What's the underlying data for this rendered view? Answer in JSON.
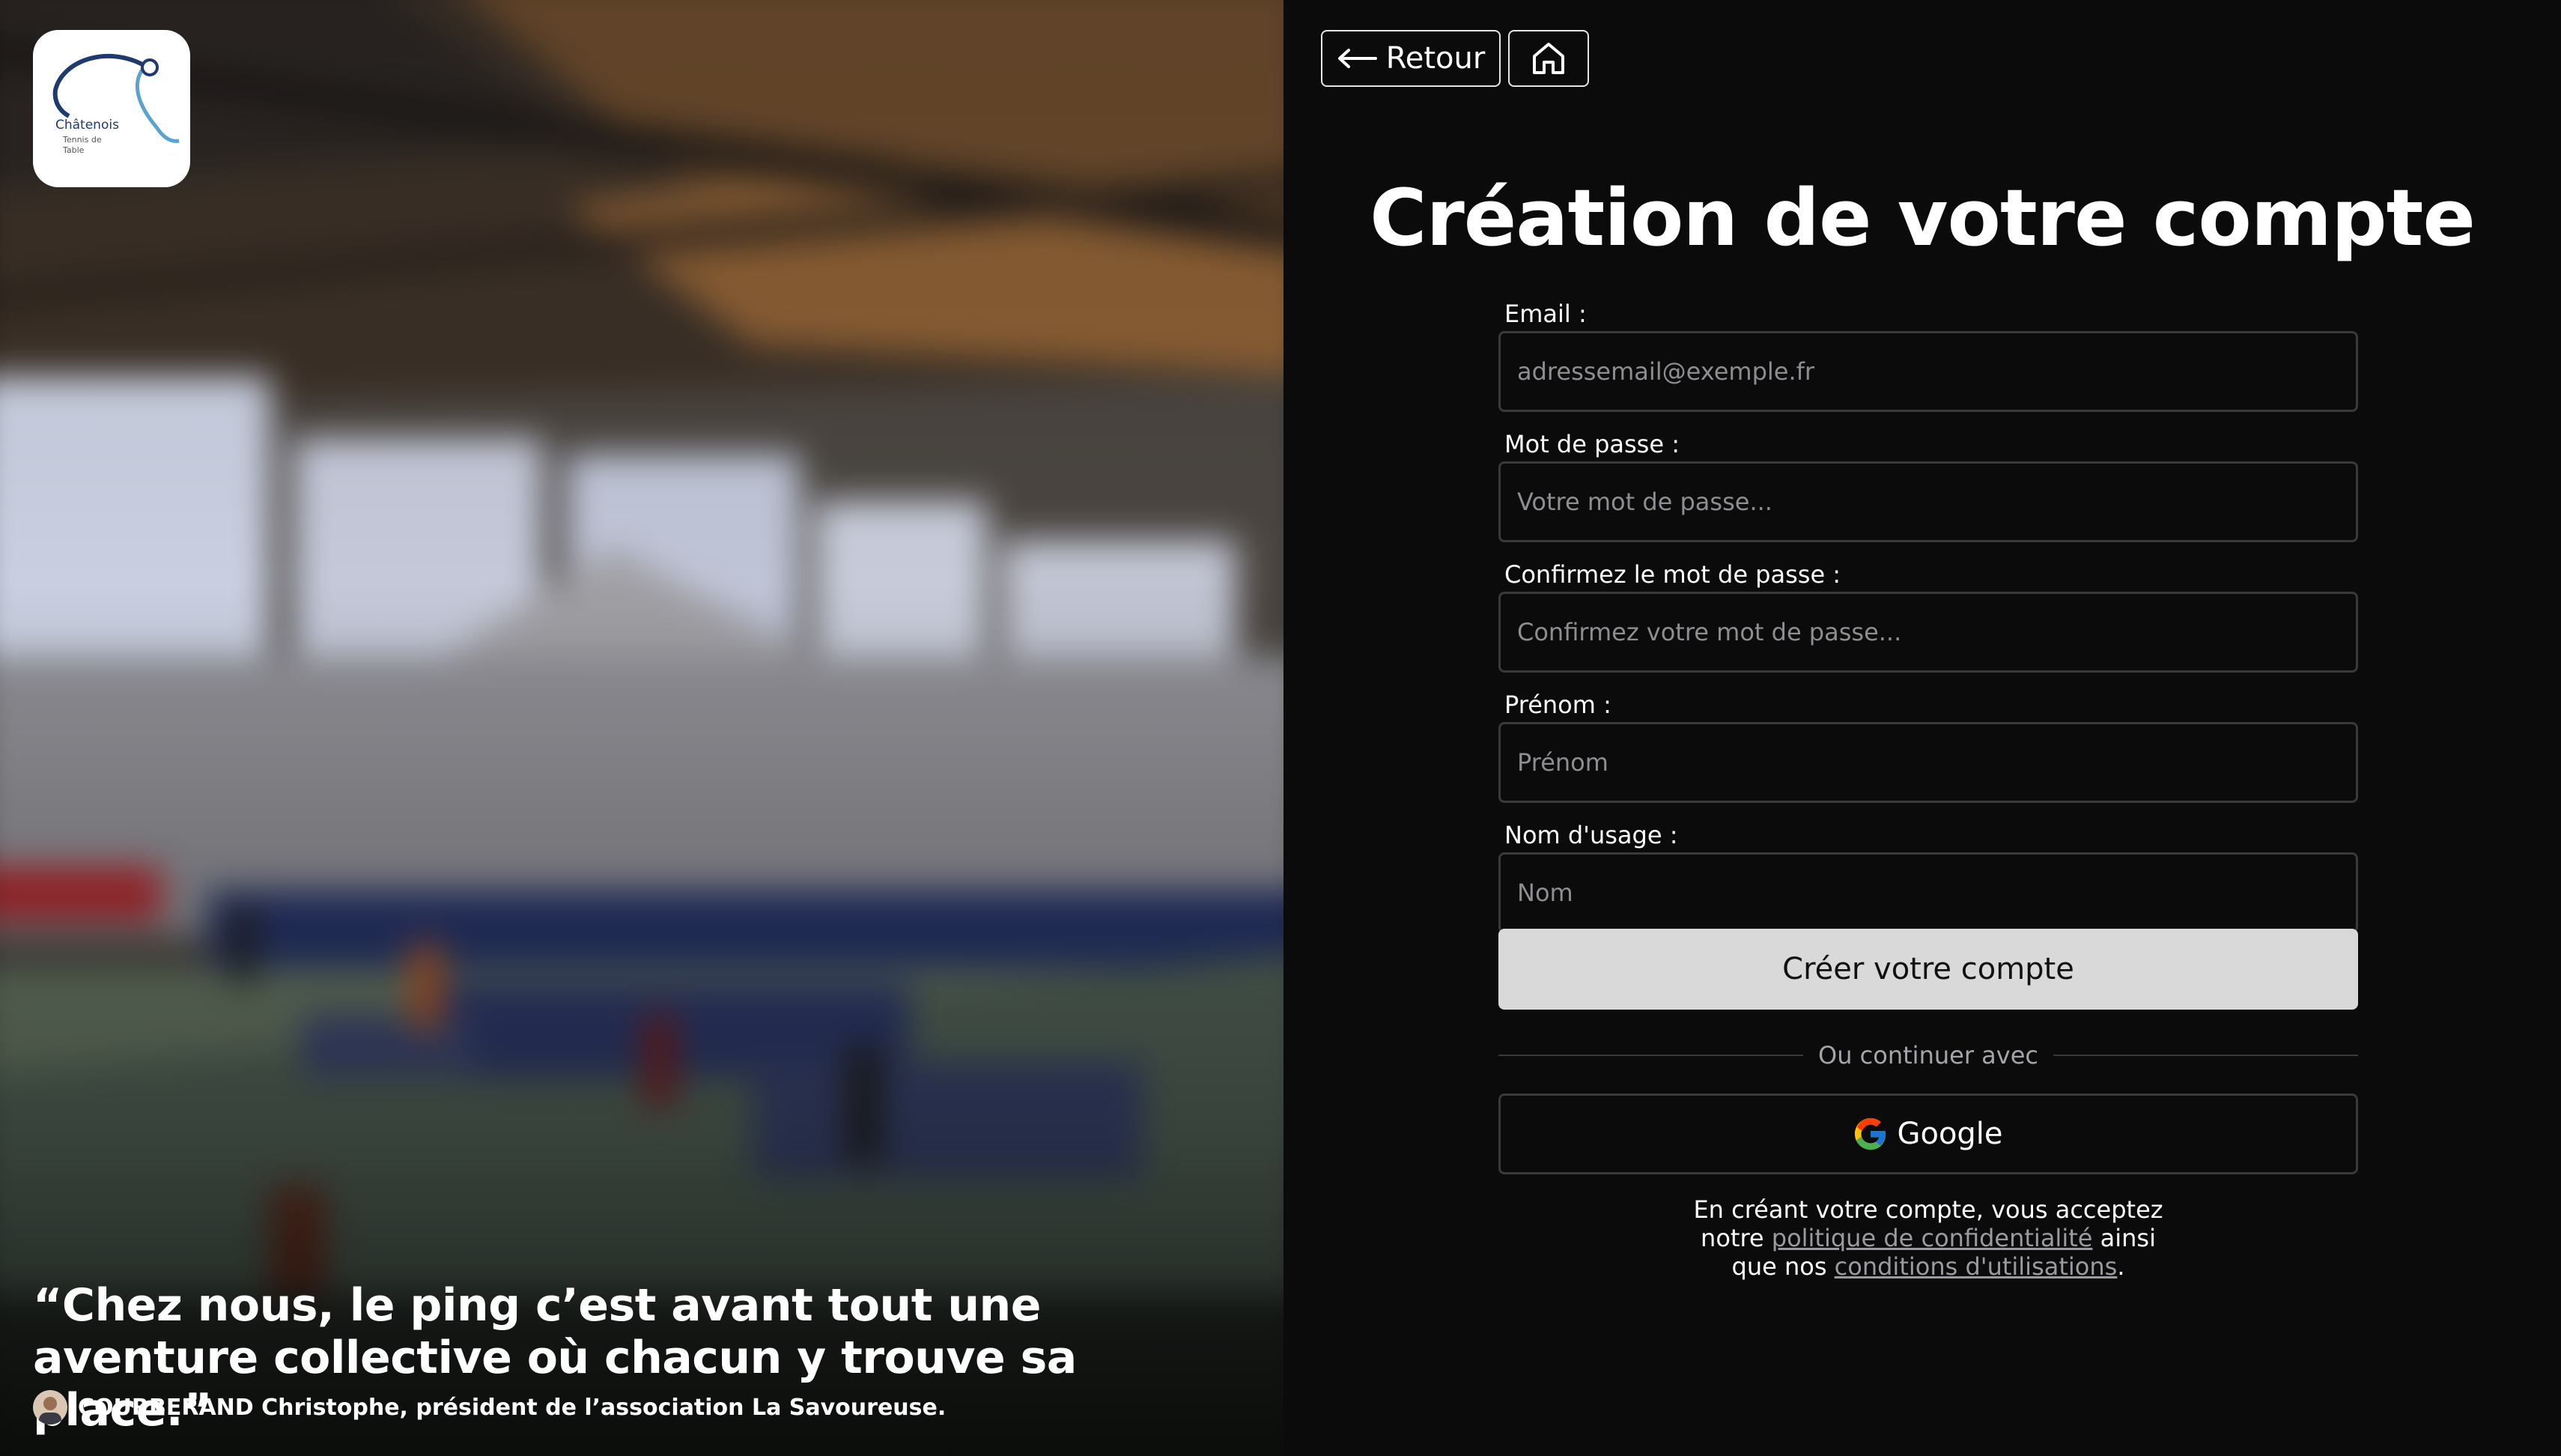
{
  "left": {
    "logo_text": [
      "Châtenois",
      "Tennis de",
      "Table"
    ],
    "quote": "“Chez nous, le ping c’est avant tout une aventure collective où chacun y trouve sa place.”",
    "author": "COURBERAND Christophe, président de l’association La Savoureuse."
  },
  "nav": {
    "back_label": "Retour",
    "back_icon": "arrow-left-icon",
    "home_icon": "home-icon"
  },
  "title": "Création de votre compte",
  "form": {
    "email": {
      "label": "Email :",
      "placeholder": "adressemail@exemple.fr",
      "value": ""
    },
    "password": {
      "label": "Mot de passe :",
      "placeholder": "Votre mot de passe...",
      "value": ""
    },
    "confirm": {
      "label": "Confirmez le mot de passe :",
      "placeholder": "Confirmez votre mot de passe...",
      "value": ""
    },
    "firstname": {
      "label": "Prénom :",
      "placeholder": "Prénom",
      "value": ""
    },
    "lastname": {
      "label": "Nom d'usage :",
      "placeholder": "Nom",
      "value": ""
    }
  },
  "create_button": "Créer votre compte",
  "divider_text": "Ou continuer avec",
  "google_button": "Google",
  "legal": {
    "part1": "En créant votre compte, vous acceptez",
    "part2": "notre",
    "privacy_link": "politique de confidentialité",
    "part3": "ainsi",
    "part4": "que nos",
    "terms_link": "conditions d'utilisations",
    "part5": "."
  },
  "colors": {
    "background": "#0b0b0c",
    "button_primary_bg": "#d9d9d9",
    "input_border": "#3a3a3d",
    "link": "#9a9aa0"
  }
}
